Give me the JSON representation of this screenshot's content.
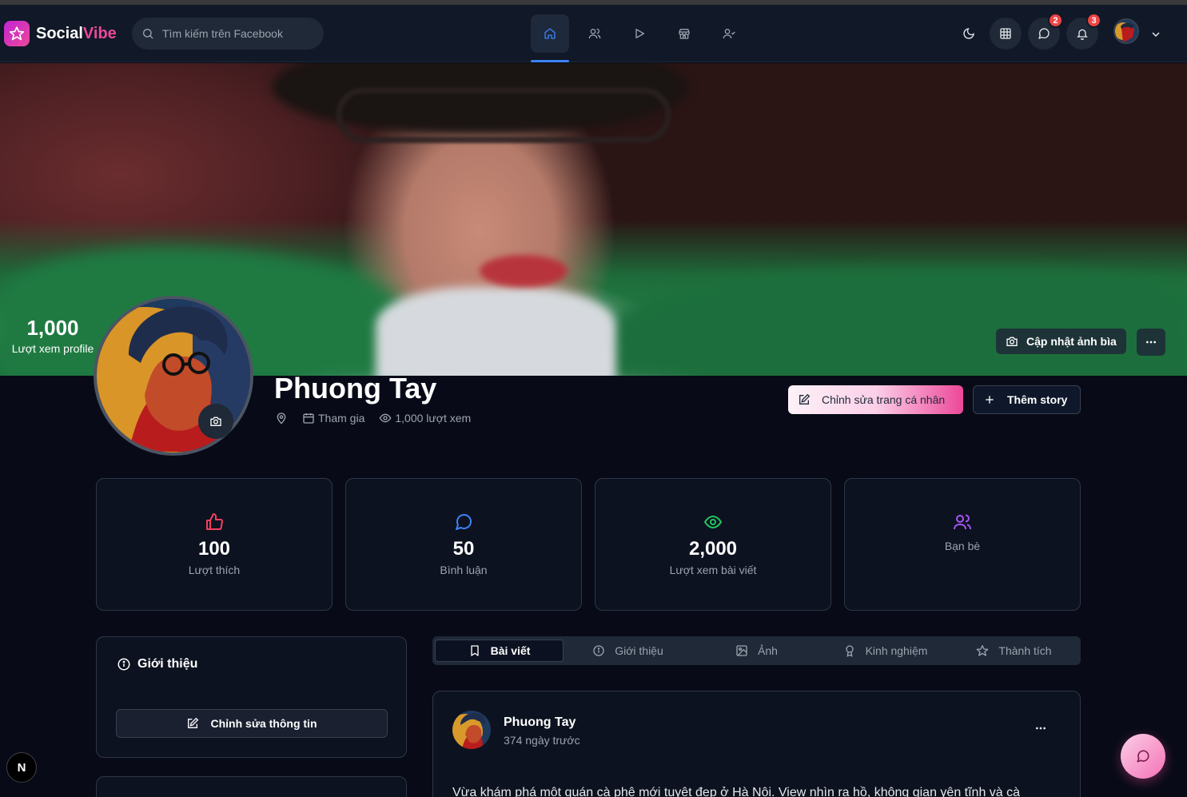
{
  "header": {
    "brand_part1": "Social",
    "brand_part2": "Vibe",
    "search_placeholder": "Tìm kiếm trên Facebook",
    "nav": [
      "home-icon",
      "friends-icon",
      "video-icon",
      "store-icon",
      "groups-icon"
    ],
    "messages_badge": "2",
    "notifications_badge": "3"
  },
  "cover": {
    "profile_views": "1,000",
    "profile_views_label": "Lượt xem profile",
    "update_cover_label": "Cập nhật ảnh bìa"
  },
  "profile": {
    "name": "Phuong Tay",
    "joined_label": "Tham gia",
    "views_label": "1,000 lượt xem",
    "edit_profile_label": "Chỉnh sửa trang cá nhân",
    "add_story_label": "Thêm story"
  },
  "stats": [
    {
      "value": "100",
      "label": "Lượt thích",
      "icon": "thumbs-up-icon",
      "color": "#f43f5e"
    },
    {
      "value": "50",
      "label": "Bình luận",
      "icon": "comment-icon",
      "color": "#3b82f6"
    },
    {
      "value": "2,000",
      "label": "Lượt xem bài viết",
      "icon": "eye-icon",
      "color": "#22c55e"
    },
    {
      "value": "",
      "label": "Bạn bè",
      "icon": "users-icon",
      "color": "#a855f7"
    }
  ],
  "intro": {
    "title": "Giới thiệu",
    "edit_info_label": "Chỉnh sửa thông tin"
  },
  "tabs": [
    {
      "label": "Bài viết",
      "icon": "bookmark-icon",
      "active": true
    },
    {
      "label": "Giới thiệu",
      "icon": "info-icon",
      "active": false
    },
    {
      "label": "Ảnh",
      "icon": "image-icon",
      "active": false
    },
    {
      "label": "Kinh nghiệm",
      "icon": "award-icon",
      "active": false
    },
    {
      "label": "Thành tích",
      "icon": "star-icon",
      "active": false
    }
  ],
  "post": {
    "author": "Phuong Tay",
    "time": "374 ngày trước",
    "text": "Vừa khám phá một quán cà phê mới tuyệt đẹp ở Hà Nội. View nhìn ra hồ, không gian yên tĩnh và cà"
  },
  "next_badge": "N"
}
